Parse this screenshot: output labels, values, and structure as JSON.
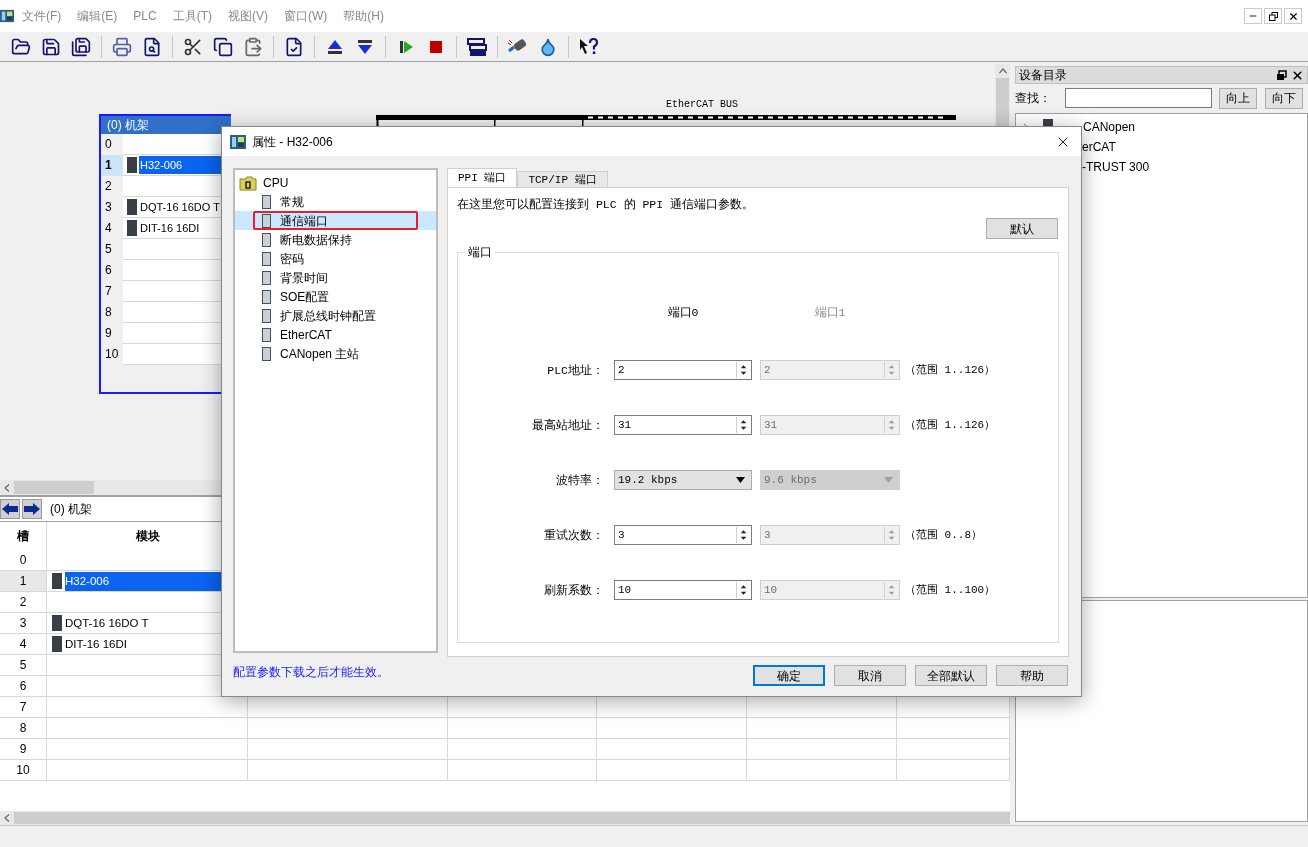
{
  "menu": [
    {
      "label": "文件(F)"
    },
    {
      "label": "编辑(E)"
    },
    {
      "label": "PLC"
    },
    {
      "label": "工具(T)"
    },
    {
      "label": "视图(V)"
    },
    {
      "label": "窗口(W)"
    },
    {
      "label": "帮助(H)"
    }
  ],
  "canvas": {
    "bus_label": "EtherCAT BUS",
    "rack": {
      "title": "(0) 机架",
      "slots": [
        {
          "slot": "0",
          "selected": false
        },
        {
          "slot": "1",
          "module": "H32-006",
          "selected": true
        },
        {
          "slot": "2",
          "selected": false
        },
        {
          "slot": "3",
          "module": "DQT-16 16DO T",
          "selected": false
        },
        {
          "slot": "4",
          "module": "DIT-16 16DI",
          "selected": false
        },
        {
          "slot": "5",
          "selected": false
        },
        {
          "slot": "6",
          "selected": false
        },
        {
          "slot": "7",
          "selected": false
        },
        {
          "slot": "8",
          "selected": false
        },
        {
          "slot": "9",
          "selected": false
        },
        {
          "slot": "10",
          "selected": false
        }
      ]
    }
  },
  "catalog": {
    "title": "设备目录",
    "search_label": "查找：",
    "buttons": [
      "向上",
      "向下"
    ],
    "items": [
      {
        "label": "CANopen",
        "kind": "node"
      },
      {
        "label": "erCAT",
        "kind": "text"
      },
      {
        "label": "-TRUST 300",
        "kind": "text"
      }
    ]
  },
  "rack_table": {
    "title": "(0) 机架",
    "columns": [
      "槽",
      "模块"
    ],
    "rows": [
      {
        "slot": "0",
        "selected": false
      },
      {
        "slot": "1",
        "module": "H32-006",
        "selected": true
      },
      {
        "slot": "2",
        "selected": false
      },
      {
        "slot": "3",
        "module": "DQT-16 16DO T",
        "selected": false
      },
      {
        "slot": "4",
        "module": "DIT-16 16DI",
        "selected": false
      },
      {
        "slot": "5",
        "selected": false
      },
      {
        "slot": "6",
        "selected": false
      },
      {
        "slot": "7",
        "selected": false
      },
      {
        "slot": "8",
        "selected": false
      },
      {
        "slot": "9",
        "selected": false
      },
      {
        "slot": "10",
        "selected": false
      }
    ]
  },
  "dialog": {
    "title": "属性 - H32-006",
    "tree": {
      "label": "CPU",
      "children": [
        {
          "label": "常规",
          "selected": false,
          "highlighted": false
        },
        {
          "label": "通信端口",
          "selected": true,
          "highlighted": true
        },
        {
          "label": "断电数据保持",
          "selected": false,
          "highlighted": false
        },
        {
          "label": "密码",
          "selected": false,
          "highlighted": false
        },
        {
          "label": "背景时间",
          "selected": false,
          "highlighted": false
        },
        {
          "label": "SOE配置",
          "selected": false,
          "highlighted": false
        },
        {
          "label": "扩展总线时钟配置",
          "selected": false,
          "highlighted": false
        },
        {
          "label": "EtherCAT",
          "selected": false,
          "highlighted": false
        },
        {
          "label": "CANopen 主站",
          "selected": false,
          "highlighted": false
        }
      ]
    },
    "note": "配置参数下载之后才能生效。",
    "tabs": [
      {
        "label": "PPI 端口",
        "selected": true
      },
      {
        "label": "TCP/IP 端口",
        "selected": false
      }
    ],
    "description": "在这里您可以配置连接到 PLC 的 PPI 通信端口参数。",
    "default_button": "默认",
    "group": {
      "title": "端口",
      "port_headers": [
        {
          "label": "端口0",
          "disabled": false
        },
        {
          "label": "端口1",
          "disabled": true
        }
      ],
      "rows": [
        {
          "label": "PLC地址：",
          "kind": "spin",
          "fields": [
            {
              "value": "2",
              "disabled": false
            },
            {
              "value": "2",
              "disabled": true
            }
          ],
          "range": "（范围 1..126）"
        },
        {
          "label": "最高站地址：",
          "kind": "spin",
          "fields": [
            {
              "value": "31",
              "disabled": false
            },
            {
              "value": "31",
              "disabled": true
            }
          ],
          "range": "（范围 1..126）"
        },
        {
          "label": "波特率：",
          "kind": "dropdown",
          "fields": [
            {
              "value": "19.2 kbps",
              "disabled": false
            },
            {
              "value": "9.6 kbps",
              "disabled": true
            }
          ]
        },
        {
          "label": "重试次数：",
          "kind": "spin",
          "fields": [
            {
              "value": "3",
              "disabled": false
            },
            {
              "value": "3",
              "disabled": true
            }
          ],
          "range": "（范围 0..8）"
        },
        {
          "label": "刷新系数：",
          "kind": "spin",
          "fields": [
            {
              "value": "10",
              "disabled": false
            },
            {
              "value": "10",
              "disabled": true
            }
          ],
          "range": "（范围 1..100）"
        }
      ]
    },
    "buttons": [
      {
        "label": "确定",
        "default": true
      },
      {
        "label": "取消",
        "default": false
      },
      {
        "label": "全部默认",
        "default": false
      },
      {
        "label": "帮助",
        "default": false
      }
    ]
  }
}
